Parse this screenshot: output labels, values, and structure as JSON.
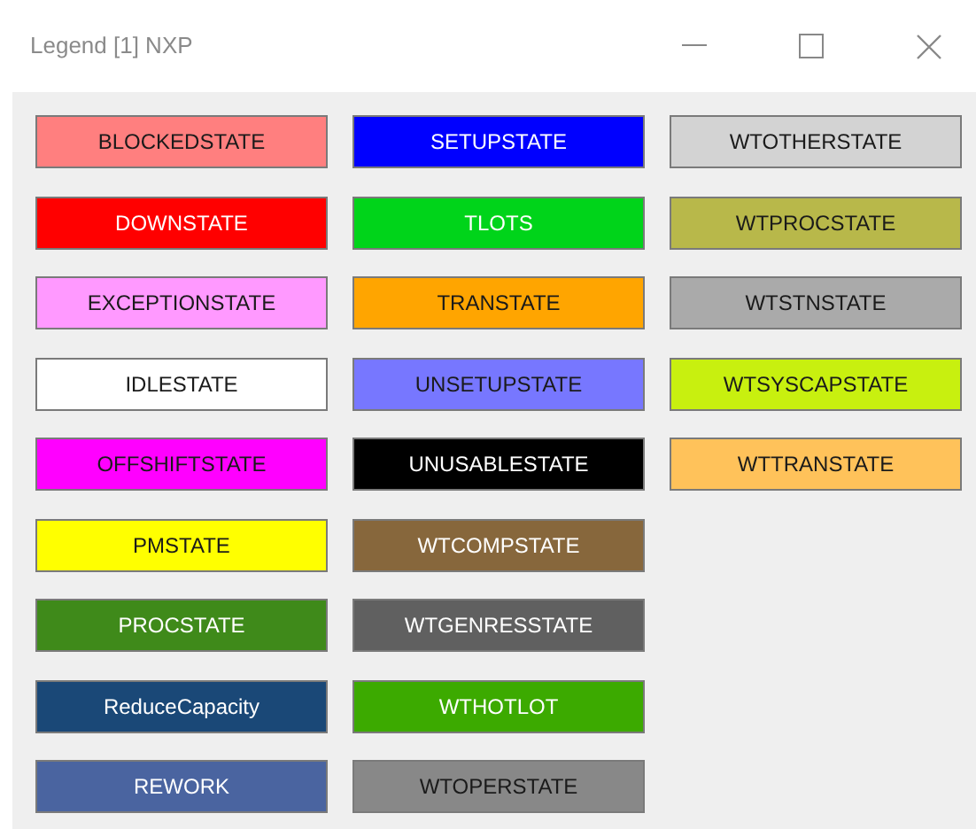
{
  "window": {
    "title": "Legend [1] NXP"
  },
  "columns": [
    [
      {
        "label": "BLOCKEDSTATE",
        "color": "#ff7f7f",
        "light_text": false
      },
      {
        "label": "DOWNSTATE",
        "color": "#ff0000",
        "light_text": true
      },
      {
        "label": "EXCEPTIONSTATE",
        "color": "#ff99ff",
        "light_text": false
      },
      {
        "label": "IDLESTATE",
        "color": "#ffffff",
        "light_text": false
      },
      {
        "label": "OFFSHIFTSTATE",
        "color": "#ff00ff",
        "light_text": false
      },
      {
        "label": "PMSTATE",
        "color": "#ffff00",
        "light_text": false
      },
      {
        "label": "PROCSTATE",
        "color": "#3f8a1a",
        "light_text": true
      },
      {
        "label": "ReduceCapacity",
        "color": "#1a4877",
        "light_text": true
      },
      {
        "label": "REWORK",
        "color": "#4a64a0",
        "light_text": true
      }
    ],
    [
      {
        "label": "SETUPSTATE",
        "color": "#0000ff",
        "light_text": true
      },
      {
        "label": "TLOTS",
        "color": "#00d41a",
        "light_text": true
      },
      {
        "label": "TRANSTATE",
        "color": "#ffa500",
        "light_text": false
      },
      {
        "label": "UNSETUPSTATE",
        "color": "#7777ff",
        "light_text": false
      },
      {
        "label": "UNUSABLESTATE",
        "color": "#000000",
        "light_text": true
      },
      {
        "label": "WTCOMPSTATE",
        "color": "#87673c",
        "light_text": true
      },
      {
        "label": "WTGENRESSTATE",
        "color": "#606060",
        "light_text": true
      },
      {
        "label": "WTHOTLOT",
        "color": "#3caa00",
        "light_text": true
      },
      {
        "label": "WTOPERSTATE",
        "color": "#888888",
        "light_text": false
      }
    ],
    [
      {
        "label": "WTOTHERSTATE",
        "color": "#d3d3d3",
        "light_text": false
      },
      {
        "label": "WTPROCSTATE",
        "color": "#b8b84a",
        "light_text": false
      },
      {
        "label": "WTSTNSTATE",
        "color": "#aaaaaa",
        "light_text": false
      },
      {
        "label": "WTSYSCAPSTATE",
        "color": "#c8f00f",
        "light_text": false
      },
      {
        "label": "WTTRANSTATE",
        "color": "#ffc25a",
        "light_text": false
      }
    ]
  ]
}
